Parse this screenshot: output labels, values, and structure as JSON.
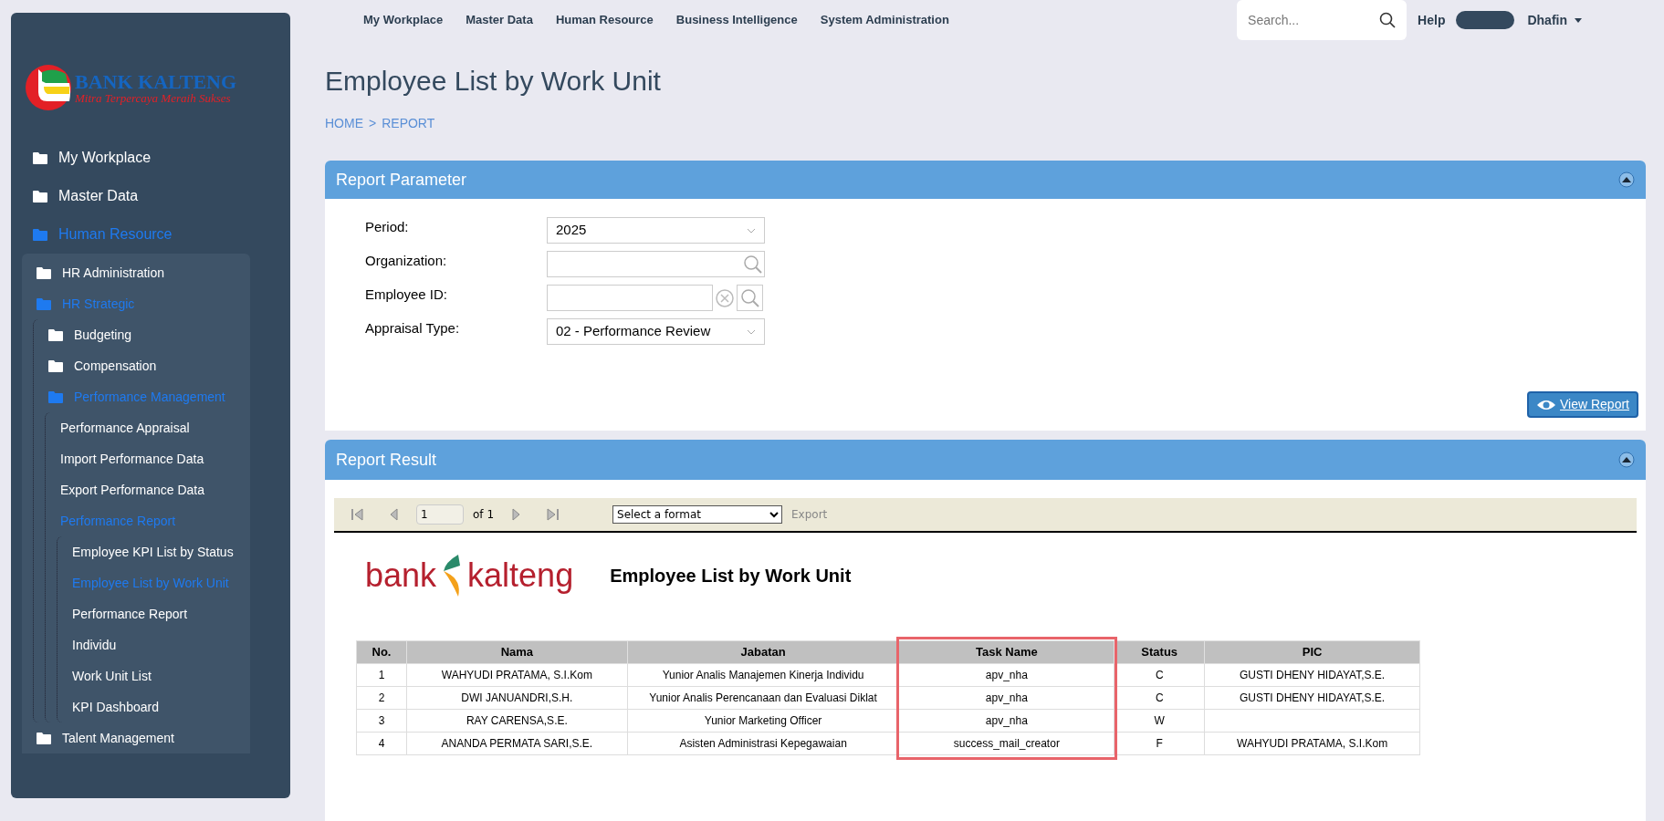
{
  "logo": {
    "name": "BANK KALTENG",
    "tagline": "Mitra Terpercaya Meraih Sukses"
  },
  "sidebar": {
    "items": [
      {
        "label": "My Workplace",
        "kind": "folder",
        "active": false
      },
      {
        "label": "Master Data",
        "kind": "folder",
        "active": false
      },
      {
        "label": "Human Resource",
        "kind": "folder",
        "active": true,
        "children": [
          {
            "label": "HR Administration",
            "kind": "folder",
            "active": false
          },
          {
            "label": "HR Strategic",
            "kind": "folder",
            "active": true,
            "children": [
              {
                "label": "Budgeting",
                "kind": "folder",
                "active": false
              },
              {
                "label": "Compensation",
                "kind": "folder",
                "active": false
              },
              {
                "label": "Performance Management",
                "kind": "folder",
                "active": true,
                "children": [
                  {
                    "label": "Performance Appraisal",
                    "kind": "page",
                    "active": false
                  },
                  {
                    "label": "Import Performance Data",
                    "kind": "page",
                    "active": false
                  },
                  {
                    "label": "Export Performance Data",
                    "kind": "page",
                    "active": false
                  },
                  {
                    "label": "Performance Report",
                    "kind": "page",
                    "active": true,
                    "children": [
                      {
                        "label": "Employee KPI List by Status",
                        "kind": "page",
                        "active": false
                      },
                      {
                        "label": "Employee List by Work Unit",
                        "kind": "page",
                        "active": true
                      },
                      {
                        "label": "Performance Report",
                        "kind": "page",
                        "active": false
                      },
                      {
                        "label": "Individu",
                        "kind": "page",
                        "active": false
                      },
                      {
                        "label": "Work Unit List",
                        "kind": "page",
                        "active": false
                      },
                      {
                        "label": "KPI Dashboard",
                        "kind": "page",
                        "active": false
                      }
                    ]
                  }
                ]
              }
            ]
          },
          {
            "label": "Talent Management",
            "kind": "folder",
            "active": false
          }
        ]
      }
    ]
  },
  "top_nav": [
    "My Workplace",
    "Master Data",
    "Human Resource",
    "Business Intelligence",
    "System Administration"
  ],
  "search": {
    "placeholder": "Search..."
  },
  "help": "Help",
  "user": "Dhafin",
  "page_title": "Employee List by Work Unit",
  "breadcrumb": [
    "HOME",
    ">",
    "REPORT"
  ],
  "report_parameter": {
    "title": "Report Parameter",
    "fields": [
      {
        "label": "Period:",
        "kind": "select",
        "value": "2025"
      },
      {
        "label": "Organization:",
        "kind": "lookup"
      },
      {
        "label": "Employee ID:",
        "kind": "lookup_clear"
      },
      {
        "label": "Appraisal Type:",
        "kind": "select",
        "value": "02 - Performance Review"
      }
    ],
    "button": "View Report"
  },
  "report_result": {
    "title": "Report Result",
    "toolbar": {
      "page": "1",
      "of": "of 1",
      "format": "Select a format",
      "export": "Export"
    },
    "report_logo": {
      "left": "bank",
      "right": "kalteng"
    },
    "report_title": "Employee List by Work Unit",
    "table": {
      "columns": [
        {
          "label": "No.",
          "highlighted": false
        },
        {
          "label": "Nama",
          "highlighted": false
        },
        {
          "label": "Jabatan",
          "highlighted": false
        },
        {
          "label": "Task Name",
          "highlighted": true
        },
        {
          "label": "Status",
          "highlighted": false
        },
        {
          "label": "PIC",
          "highlighted": false
        }
      ],
      "rows": [
        [
          "1",
          "WAHYUDI PRATAMA, S.I.Kom",
          "Yunior Analis Manajemen Kinerja Individu",
          "apv_nha",
          "C",
          "GUSTI DHENY HIDAYAT,S.E."
        ],
        [
          "2",
          "DWI JANUANDRI,S.H.",
          "Yunior Analis Perencanaan dan  Evaluasi Diklat",
          "apv_nha",
          "C",
          "GUSTI DHENY HIDAYAT,S.E."
        ],
        [
          "3",
          "RAY CARENSA,S.E.",
          "Yunior Marketing Officer",
          "apv_nha",
          "W",
          ""
        ],
        [
          "4",
          "ANANDA PERMATA SARI,S.E.",
          "Asisten Administrasi Kepegawaian",
          "success_mail_creator",
          "F",
          "WAHYUDI PRATAMA, S.I.Kom"
        ]
      ]
    }
  }
}
